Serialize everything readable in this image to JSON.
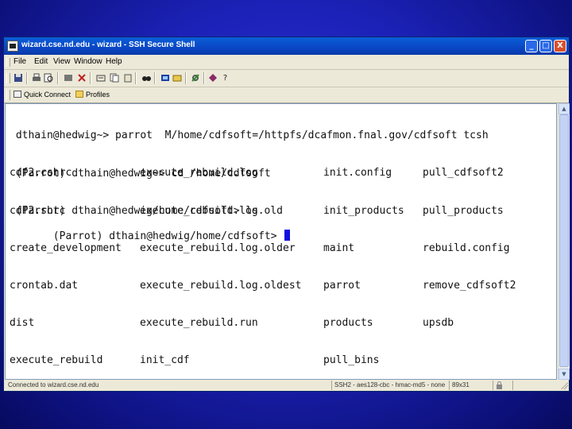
{
  "window": {
    "title": "wizard.cse.nd.edu - wizard - SSH Secure Shell",
    "buttons": {
      "minimize": "_",
      "maximize": "□",
      "close": "X"
    }
  },
  "menu": [
    "File",
    "Edit",
    "View",
    "Window",
    "Help"
  ],
  "toolbar_icons": [
    "save-icon",
    "print-icon",
    "print-preview-icon",
    "copy-icon",
    "paste-icon",
    "undo-icon",
    "cut-icon",
    "paste-special-icon",
    "find-icon",
    "new-terminal-icon",
    "new-file-transfer-icon",
    "settings-icon",
    "profiles-icon",
    "help-icon"
  ],
  "profile_bar": {
    "quick_connect": "Quick Connect",
    "profiles": "Profiles"
  },
  "terminal": {
    "lines": [
      " dthain@hedwig~> parrot  M/home/cdfsoft=/httpfs/dcafmon.fnal.gov/cdfsoft tcsh",
      " (Parrot) dthain@hedwig~> cd /home/cdfsoft",
      " (Parrot) dthain@hedwig/home/cdfsoft> ls"
    ],
    "ls_columns": [
      [
        "cdf2.cshrc",
        "cdf2.shrc",
        "create_development",
        "crontab.dat",
        "dist",
        "execute_rebuild"
      ],
      [
        "execute_rebuild.log",
        "execute_rebuild.log.old",
        "execute_rebuild.log.older",
        "execute_rebuild.log.oldest",
        "execute_rebuild.run",
        "init_cdf"
      ],
      [
        "init.config",
        "init_products",
        "maint",
        "parrot",
        "products",
        "pull_bins"
      ],
      [
        "pull_cdfsoft2",
        "pull_products",
        "rebuild.config",
        "remove_cdfsoft2",
        "upsdb"
      ]
    ],
    "prompt": " (Parrot) dthain@hedwig/home/cdfsoft> "
  },
  "status": {
    "connection": "Connected to wizard.cse.nd.edu",
    "protocol": "SSH2 - aes128-cbc - hmac-md5 - none",
    "size": "89x31"
  },
  "colors": {
    "desktop": "#1c22b8",
    "titlebar": "#0a46c4",
    "cursor": "#1010e0"
  }
}
